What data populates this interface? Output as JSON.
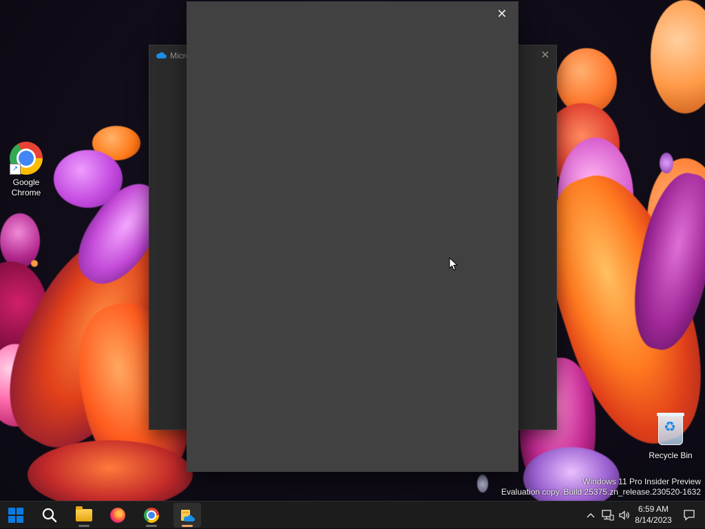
{
  "desktop": {
    "icons": [
      {
        "label": "Google Chrome"
      },
      {
        "label": "Recycle Bin"
      }
    ]
  },
  "windows": {
    "background": {
      "title": "Micro",
      "close_glyph": "✕",
      "icon": "onedrive-cloud-icon"
    },
    "foreground": {
      "close_glyph": "✕"
    }
  },
  "watermark": {
    "line1": "Windows 11 Pro Insider Preview",
    "line2": "Evaluation copy. Build 25375.zn_release.230520-1632"
  },
  "taskbar": {
    "apps": [
      {
        "name": "start",
        "icon": "windows-start-icon"
      },
      {
        "name": "search",
        "icon": "search-icon"
      },
      {
        "name": "file-explorer",
        "icon": "folder-icon"
      },
      {
        "name": "firefox",
        "icon": "firefox-icon"
      },
      {
        "name": "chrome",
        "icon": "chrome-icon"
      },
      {
        "name": "onedrive",
        "icon": "onedrive-icon",
        "active": true
      }
    ],
    "tray": {
      "chevron": "^",
      "network_icon": "network-icon",
      "volume_icon": "volume-icon",
      "notification_icon": "notification-icon"
    },
    "clock": {
      "time": "6:59 AM",
      "date": "8/14/2023"
    }
  },
  "colors": {
    "taskbar_bg": "#1c1c1c",
    "front_window_bg": "#414141",
    "back_window_bg": "#2b2b2b",
    "accent_active": "#e8a36b",
    "windows_blue": "#0a7ce0"
  }
}
